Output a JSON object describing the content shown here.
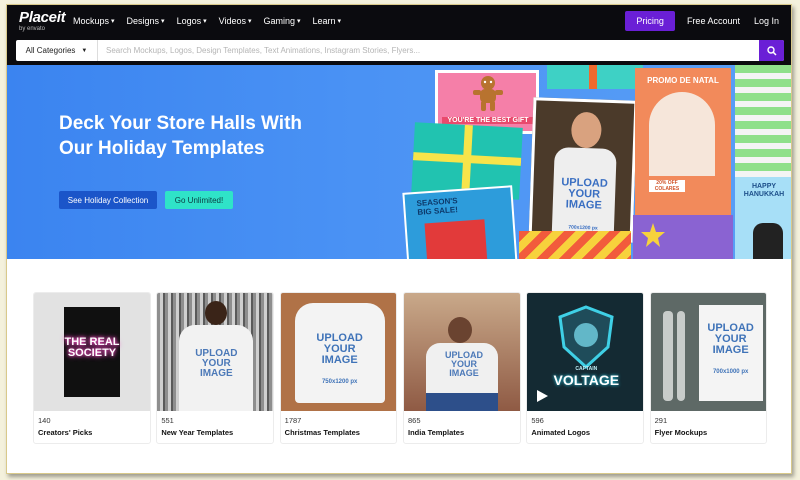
{
  "logo": {
    "main": "Placeit",
    "sub": "by envato"
  },
  "nav": {
    "items": [
      {
        "label": "Mockups"
      },
      {
        "label": "Designs"
      },
      {
        "label": "Logos"
      },
      {
        "label": "Videos"
      },
      {
        "label": "Gaming"
      },
      {
        "label": "Learn"
      }
    ],
    "pricing": "Pricing",
    "free_account": "Free Account",
    "login": "Log In"
  },
  "search": {
    "category": "All Categories",
    "placeholder": "Search Mockups, Logos, Design Templates, Text Animations, Instagram Stories, Flyers..."
  },
  "hero": {
    "title": "Deck Your Store Halls With Our Holiday Templates",
    "primary_button": "See Holiday Collection",
    "secondary_button": "Go Unlimited!",
    "tiles": {
      "best_gift": "YOU'RE THE BEST GIFT",
      "promo": "PROMO DE NATAL",
      "sale": "SEASON'S BIG SALE!",
      "hanukkah": "HAPPY HANUKKAH",
      "upload": "UPLOAD YOUR IMAGE",
      "upload_size": "700x1200 px",
      "colares": "20% OFF COLARES"
    }
  },
  "categories": [
    {
      "count": "140",
      "title": "Creators' Picks",
      "art": "THE REAL SOCIETY"
    },
    {
      "count": "551",
      "title": "New Year Templates",
      "art": "UPLOAD YOUR IMAGE"
    },
    {
      "count": "1787",
      "title": "Christmas Templates",
      "art": "UPLOAD YOUR IMAGE",
      "art_size": "750x1200 px"
    },
    {
      "count": "865",
      "title": "India Templates",
      "art": "UPLOAD YOUR IMAGE"
    },
    {
      "count": "596",
      "title": "Animated Logos",
      "art": "VOLTAGE",
      "art_sub": "CAPTAIN"
    },
    {
      "count": "291",
      "title": "Flyer Mockups",
      "art": "UPLOAD YOUR IMAGE",
      "art_size": "700x1000 px"
    }
  ],
  "colors": {
    "nav_bg": "#0b0b0f",
    "accent_purple": "#6a1fd6",
    "hero_blue": "#4a92f4",
    "hero_btn_dark": "#1b55c9",
    "hero_btn_teal": "#2fe3c8"
  },
  "icons": [
    "search-icon",
    "chevron-down-icon",
    "play-icon"
  ]
}
